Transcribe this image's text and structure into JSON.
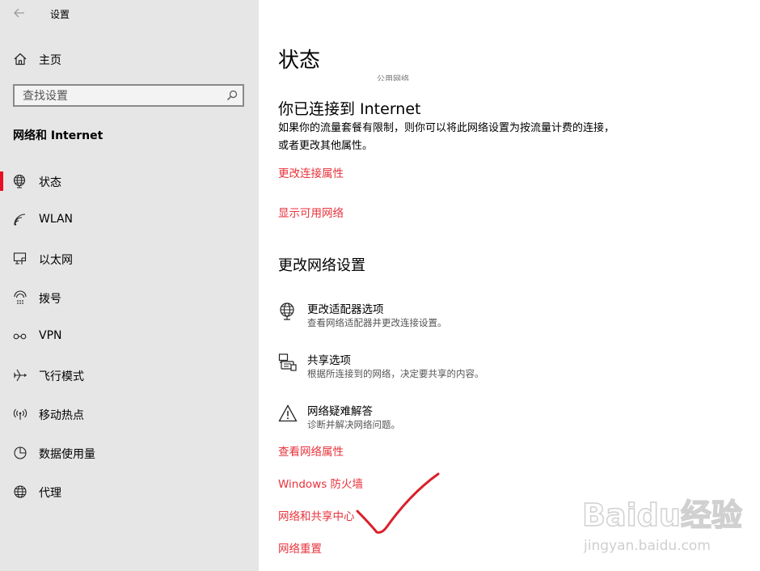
{
  "window": {
    "title": "设置"
  },
  "sidebar": {
    "home_label": "主页",
    "search_placeholder": "查找设置",
    "section_title": "网络和 Internet",
    "items": [
      {
        "label": "状态",
        "icon": "globe-icon"
      },
      {
        "label": "WLAN",
        "icon": "wifi-icon"
      },
      {
        "label": "以太网",
        "icon": "ethernet-icon"
      },
      {
        "label": "拨号",
        "icon": "dialup-icon"
      },
      {
        "label": "VPN",
        "icon": "vpn-icon"
      },
      {
        "label": "飞行模式",
        "icon": "airplane-icon"
      },
      {
        "label": "移动热点",
        "icon": "hotspot-icon"
      },
      {
        "label": "数据使用量",
        "icon": "data-usage-icon"
      },
      {
        "label": "代理",
        "icon": "globe-icon"
      }
    ]
  },
  "main": {
    "title": "状态",
    "cut_text": "公用网络",
    "connected_heading": "你已连接到 Internet",
    "connected_desc": "如果你的流量套餐有限制，则你可以将此网络设置为按流量计费的连接，或者更改其他属性。",
    "link_change_props": "更改连接属性",
    "link_show_networks": "显示可用网络",
    "change_heading": "更改网络设置",
    "options": [
      {
        "title": "更改适配器选项",
        "desc": "查看网络适配器并更改连接设置。"
      },
      {
        "title": "共享选项",
        "desc": "根据所连接到的网络，决定要共享的内容。"
      },
      {
        "title": "网络疑难解答",
        "desc": "诊断并解决网络问题。"
      }
    ],
    "link_view_props": "查看网络属性",
    "link_firewall": "Windows 防火墙",
    "link_sharing_center": "网络和共享中心",
    "link_reset": "网络重置"
  },
  "watermark": {
    "brand": "Baidu经验",
    "url": "jingyan.baidu.com"
  },
  "colors": {
    "accent": "#e8323b",
    "active_bar": "#e81123",
    "sidebar_bg": "#e6e6e6"
  }
}
